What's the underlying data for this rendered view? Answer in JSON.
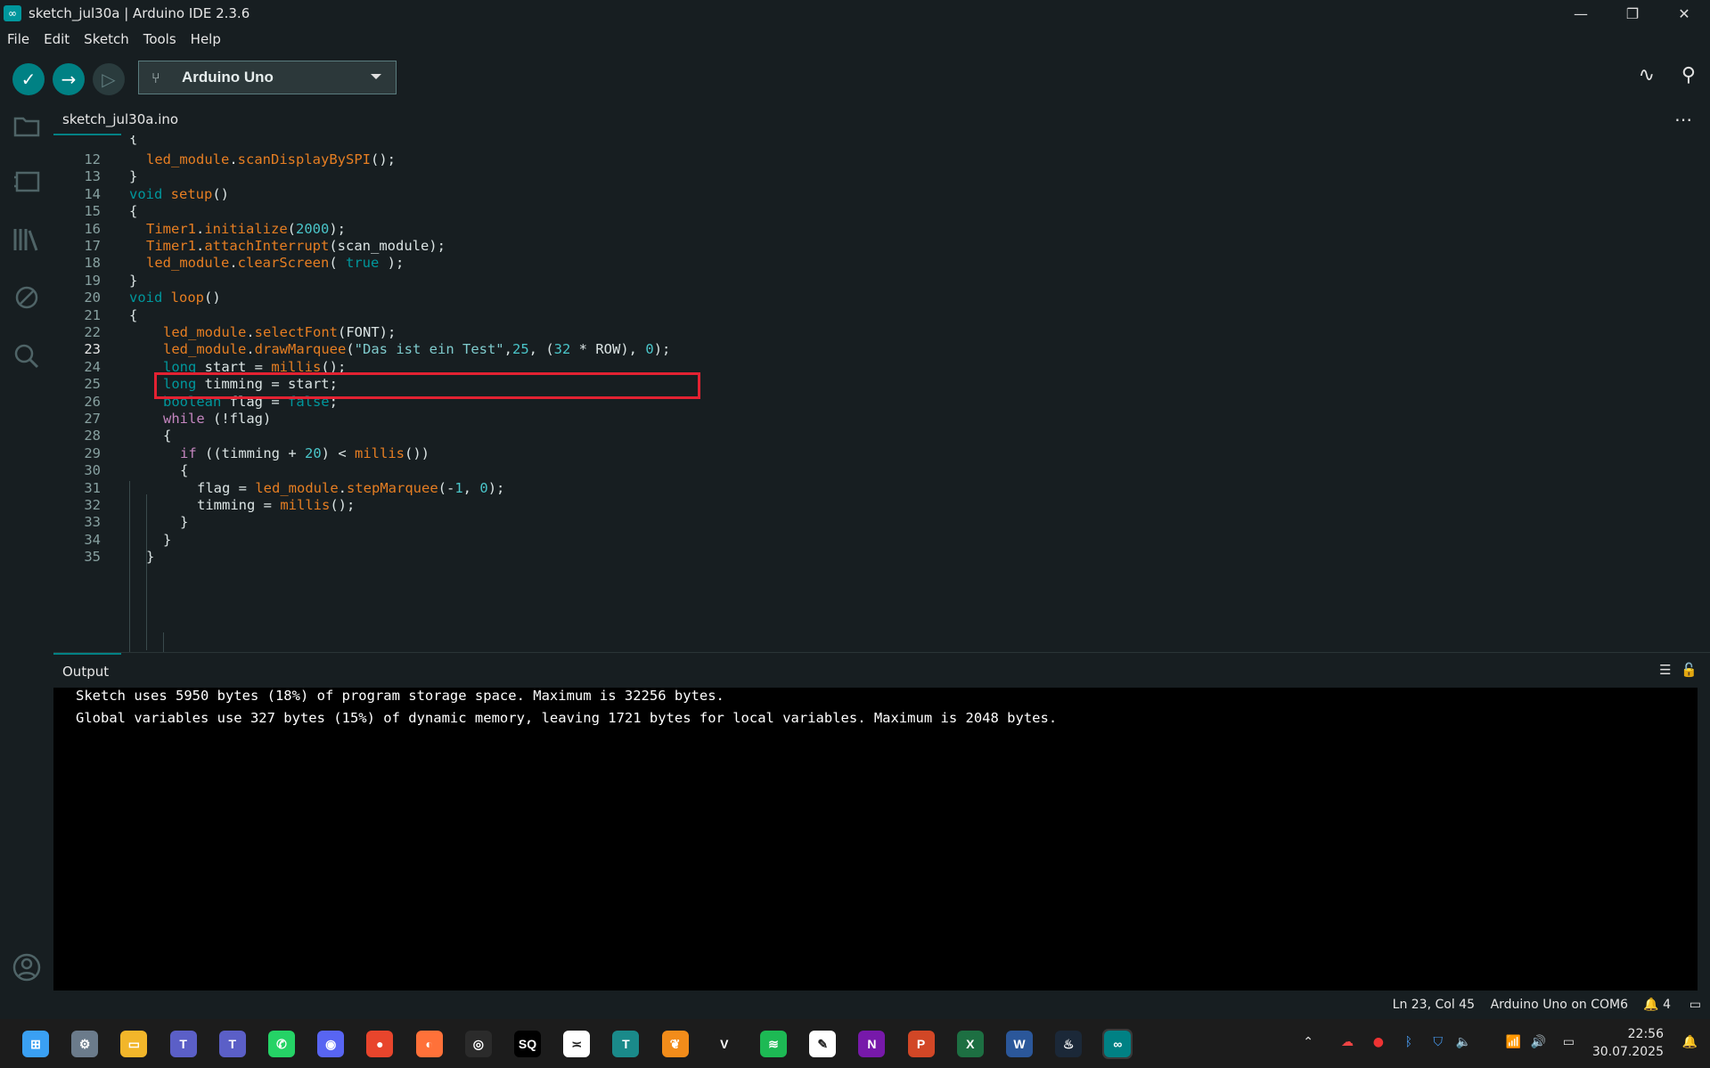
{
  "window": {
    "title": "sketch_jul30a | Arduino IDE 2.3.6",
    "minimize": "—",
    "restore": "❐",
    "close": "✕"
  },
  "menu": [
    "File",
    "Edit",
    "Sketch",
    "Tools",
    "Help"
  ],
  "toolbar": {
    "verify_icon": "✓",
    "upload_icon": "→",
    "debug_icon": "▷",
    "board_usb_icon": "⑂",
    "board_name": "Arduino Uno",
    "serial_plotter_icon": "∿",
    "serial_monitor_icon": "⚲"
  },
  "sidebar": {
    "icons": [
      "folder-icon",
      "board-manager-icon",
      "library-icon",
      "debug-icon",
      "search-icon",
      "account-icon"
    ]
  },
  "tabs": {
    "file_tab": "sketch_jul30a.ino",
    "more_icon": "⋯"
  },
  "editor": {
    "active_line": "23",
    "lines": [
      {
        "n": "12",
        "code": "led_module.scanDisplayBySPI();"
      },
      {
        "n": "13",
        "code": "}"
      },
      {
        "n": "14",
        "code": "void setup()"
      },
      {
        "n": "15",
        "code": "{"
      },
      {
        "n": "16",
        "code": "Timer1.initialize(2000);"
      },
      {
        "n": "17",
        "code": "Timer1.attachInterrupt(scan_module);"
      },
      {
        "n": "18",
        "code": "led_module.clearScreen( true );"
      },
      {
        "n": "19",
        "code": "}"
      },
      {
        "n": "20",
        "code": "void loop()"
      },
      {
        "n": "21",
        "code": "{"
      },
      {
        "n": "22",
        "code": "led_module.selectFont(FONT);"
      },
      {
        "n": "23",
        "code": "led_module.drawMarquee(\"Das ist ein Test\",25, (32 * ROW), 0);"
      },
      {
        "n": "24",
        "code": "long start = millis();"
      },
      {
        "n": "25",
        "code": "long timming = start;"
      },
      {
        "n": "26",
        "code": "boolean flag = false;"
      },
      {
        "n": "27",
        "code": "while (!flag)"
      },
      {
        "n": "28",
        "code": "{"
      },
      {
        "n": "29",
        "code": "if ((timming + 20) < millis())"
      },
      {
        "n": "30",
        "code": "{"
      },
      {
        "n": "31",
        "code": "flag = led_module.stepMarquee(-1, 0);"
      },
      {
        "n": "32",
        "code": "timming = millis();"
      },
      {
        "n": "33",
        "code": "}"
      },
      {
        "n": "34",
        "code": "}"
      },
      {
        "n": "35",
        "code": "}"
      }
    ]
  },
  "output": {
    "title": "Output",
    "lines": [
      "Sketch uses 5950 bytes (18%) of program storage space. Maximum is 32256 bytes.",
      "Global variables use 327 bytes (15%) of dynamic memory, leaving 1721 bytes for local variables. Maximum is 2048 bytes."
    ],
    "clear_icon": "☰",
    "lock_icon": "🔓"
  },
  "status": {
    "cursor": "Ln 23, Col 45",
    "board_port": "Arduino Uno on COM6",
    "notifications": "4"
  },
  "taskbar": {
    "clock_time": "22:56",
    "clock_date": "30.07.2025",
    "apps": [
      "windows-start",
      "settings",
      "file-explorer",
      "teams",
      "teams-classic",
      "whatsapp",
      "discord",
      "app-red",
      "firefox",
      "obs",
      "sq",
      "app-pink",
      "app-tealblue",
      "fl-studio",
      "vivaldi",
      "spotify",
      "notes",
      "onenote",
      "powerpoint",
      "excel",
      "word",
      "steam",
      "arduino"
    ]
  },
  "colors": {
    "accent": "#008184",
    "highlight_box": "#e32232",
    "orange_token": "#e67e22",
    "keyword_token": "#00979c"
  }
}
